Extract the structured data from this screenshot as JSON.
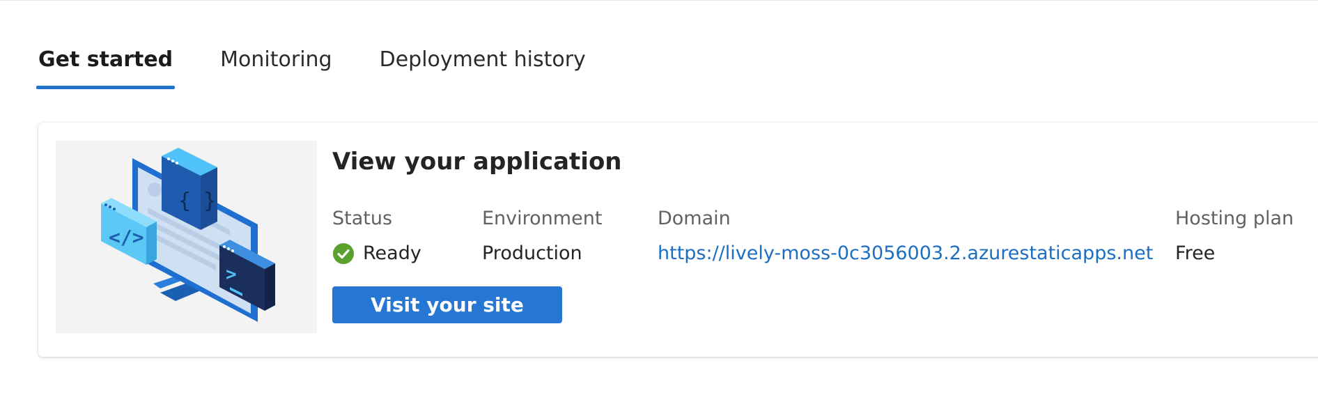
{
  "tabs": [
    {
      "label": "Get started",
      "active": true
    },
    {
      "label": "Monitoring",
      "active": false
    },
    {
      "label": "Deployment history",
      "active": false
    }
  ],
  "card": {
    "title": "View your application",
    "illustration_icon": "static-web-app-illustration",
    "fields": {
      "status": {
        "label": "Status",
        "value": "Ready",
        "icon": "check-circle-icon",
        "icon_color": "#5aa02c"
      },
      "environment": {
        "label": "Environment",
        "value": "Production"
      },
      "domain": {
        "label": "Domain",
        "value": "https://lively-moss-0c3056003.2.azurestaticapps.net"
      },
      "hosting_plan": {
        "label": "Hosting plan",
        "value": "Free"
      }
    },
    "visit_button": "Visit your site"
  },
  "colors": {
    "accent": "#2272c9",
    "button": "#2677d4",
    "link": "#1b6ec2",
    "success": "#5aa02c"
  }
}
